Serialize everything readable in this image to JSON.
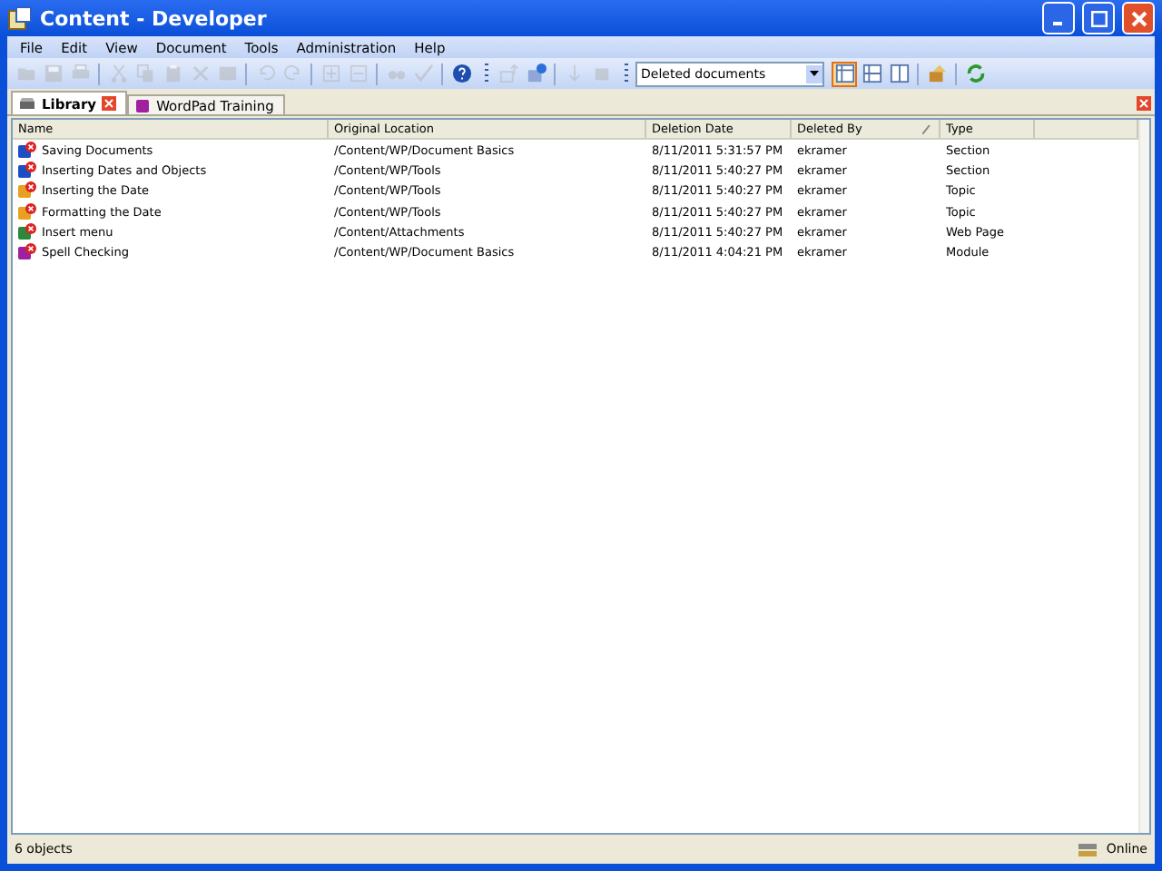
{
  "window": {
    "title": "Content - Developer"
  },
  "menu": [
    "File",
    "Edit",
    "View",
    "Document",
    "Tools",
    "Administration",
    "Help"
  ],
  "toolbar": [
    {
      "kind": "open",
      "disabled": true
    },
    {
      "kind": "save",
      "disabled": true
    },
    {
      "kind": "print",
      "disabled": true
    },
    {
      "kind": "sep"
    },
    {
      "kind": "cut",
      "disabled": true
    },
    {
      "kind": "copy",
      "disabled": true
    },
    {
      "kind": "paste",
      "disabled": true
    },
    {
      "kind": "delete",
      "disabled": true
    },
    {
      "kind": "properties",
      "disabled": true
    },
    {
      "kind": "sep"
    },
    {
      "kind": "undo",
      "disabled": true
    },
    {
      "kind": "redo",
      "disabled": true
    },
    {
      "kind": "sep"
    },
    {
      "kind": "expand",
      "disabled": true
    },
    {
      "kind": "collapse",
      "disabled": true
    },
    {
      "kind": "sep"
    },
    {
      "kind": "find",
      "disabled": true
    },
    {
      "kind": "spell",
      "disabled": true
    },
    {
      "kind": "sep"
    },
    {
      "kind": "help",
      "disabled": false
    },
    {
      "kind": "grip"
    },
    {
      "kind": "up",
      "disabled": true
    },
    {
      "kind": "publish",
      "disabled": false
    },
    {
      "kind": "sep"
    },
    {
      "kind": "down",
      "disabled": true
    },
    {
      "kind": "share",
      "disabled": true
    },
    {
      "kind": "grip"
    },
    {
      "kind": "select",
      "value": "Deleted documents"
    },
    {
      "kind": "view-details",
      "selected": true
    },
    {
      "kind": "view-horizontal",
      "selected": false
    },
    {
      "kind": "view-vertical",
      "selected": false
    },
    {
      "kind": "sep"
    },
    {
      "kind": "restore",
      "disabled": false
    },
    {
      "kind": "sep"
    },
    {
      "kind": "refresh",
      "disabled": false
    }
  ],
  "tabs": [
    {
      "label": "Library",
      "selected": true,
      "closable": true
    },
    {
      "label": "WordPad Training",
      "selected": false,
      "closable": false
    }
  ],
  "table": {
    "columns": [
      {
        "label": "Name",
        "sorted": false
      },
      {
        "label": "Original Location",
        "sorted": false
      },
      {
        "label": "Deletion Date",
        "sorted": false
      },
      {
        "label": "Deleted By",
        "sorted": true
      },
      {
        "label": "Type",
        "sorted": false
      }
    ],
    "rows": [
      {
        "kind": "section",
        "cells": [
          "Saving Documents",
          "/Content/WP/Document Basics",
          "8/11/2011 5:31:57 PM",
          "ekramer",
          "Section"
        ]
      },
      {
        "kind": "section",
        "cells": [
          "Inserting Dates and Objects",
          "/Content/WP/Tools",
          "8/11/2011 5:40:27 PM",
          "ekramer",
          "Section"
        ]
      },
      {
        "kind": "topic",
        "cells": [
          "Inserting the Date",
          "/Content/WP/Tools",
          "8/11/2011 5:40:27 PM",
          "ekramer",
          "Topic"
        ]
      },
      {
        "kind": "topic",
        "cells": [
          "Formatting the Date",
          "/Content/WP/Tools",
          "8/11/2011 5:40:27 PM",
          "ekramer",
          "Topic"
        ]
      },
      {
        "kind": "webpage",
        "cells": [
          "Insert menu",
          "/Content/Attachments",
          "8/11/2011 5:40:27 PM",
          "ekramer",
          "Web Page"
        ]
      },
      {
        "kind": "module",
        "cells": [
          "Spell Checking",
          "/Content/WP/Document Basics",
          "8/11/2011 4:04:21 PM",
          "ekramer",
          "Module"
        ]
      }
    ]
  },
  "status_bar": {
    "count": "6 objects",
    "connection": "Online"
  }
}
